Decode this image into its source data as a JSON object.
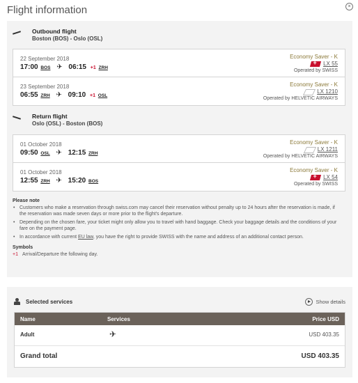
{
  "dialog": {
    "title": "Flight information",
    "close_glyph": "×"
  },
  "outbound": {
    "heading": "Outbound flight",
    "route": "Boston (BOS) - Oslo (OSL)",
    "icon": "takeoff-plane-icon",
    "segments": [
      {
        "date": "22 September 2018",
        "dep_time": "17:00",
        "dep_code": "BOS",
        "arr_time": "06:15",
        "plus": "+1",
        "arr_code": "ZRH",
        "fare": "Economy Saver - K",
        "flight": "LX 55",
        "airline_logo": "swiss-logo-icon",
        "operator": "Operated by SWISS"
      },
      {
        "date": "23 September 2018",
        "dep_time": "06:55",
        "dep_code": "ZRH",
        "arr_time": "09:10",
        "plus": "+1",
        "arr_code": "OSL",
        "fare": "Economy Saver - K",
        "flight": "LX 1210",
        "airline_logo": "helvetic-logo-icon",
        "operator": "Operated by HELVETIC AIRWAYS"
      }
    ]
  },
  "return": {
    "heading": "Return flight",
    "route": "Oslo (OSL) - Boston (BOS)",
    "icon": "landing-plane-icon",
    "segments": [
      {
        "date": "01 October 2018",
        "dep_time": "09:50",
        "dep_code": "OSL",
        "arr_time": "12:15",
        "plus": "",
        "arr_code": "ZRH",
        "fare": "Economy Saver - K",
        "flight": "LX 1211",
        "airline_logo": "helvetic-logo-icon",
        "operator": "Operated by HELVETIC AIRWAYS"
      },
      {
        "date": "01 October 2018",
        "dep_time": "12:55",
        "dep_code": "ZRH",
        "arr_time": "15:20",
        "plus": "",
        "arr_code": "BOS",
        "fare": "Economy Saver - K",
        "flight": "LX 54",
        "airline_logo": "swiss-logo-icon",
        "operator": "Operated by SWISS"
      }
    ]
  },
  "notes": {
    "heading": "Please note",
    "items": [
      "Customers who make a reservation through swiss.com may cancel their reservation without penalty up to 24 hours after the reservation is made, if the reservation was made seven days or more prior to the flight's departure.",
      "Depending on the chosen fare, your ticket might only allow you to travel with hand baggage. Check your baggage details and the conditions of your fare on the payment page."
    ],
    "eu_prefix": "In accordance with current ",
    "eu_link": "EU law",
    "eu_suffix": ", you have the right to provide SWISS with the name and address of an additional contact person.",
    "symbols_heading": "Symbols",
    "symbol_plus": "+1",
    "symbol_text": "Arrival/Departure the following day."
  },
  "services": {
    "heading": "Selected services",
    "show_details": "Show details",
    "columns": {
      "name": "Name",
      "services": "Services",
      "price": "Price USD"
    },
    "rows": [
      {
        "name": "Adult",
        "service_icon": "plane-icon",
        "service_glyph": "✈",
        "price": "USD  403.35"
      }
    ],
    "grand_total_label": "Grand total",
    "grand_total_value": "USD  403.35"
  }
}
